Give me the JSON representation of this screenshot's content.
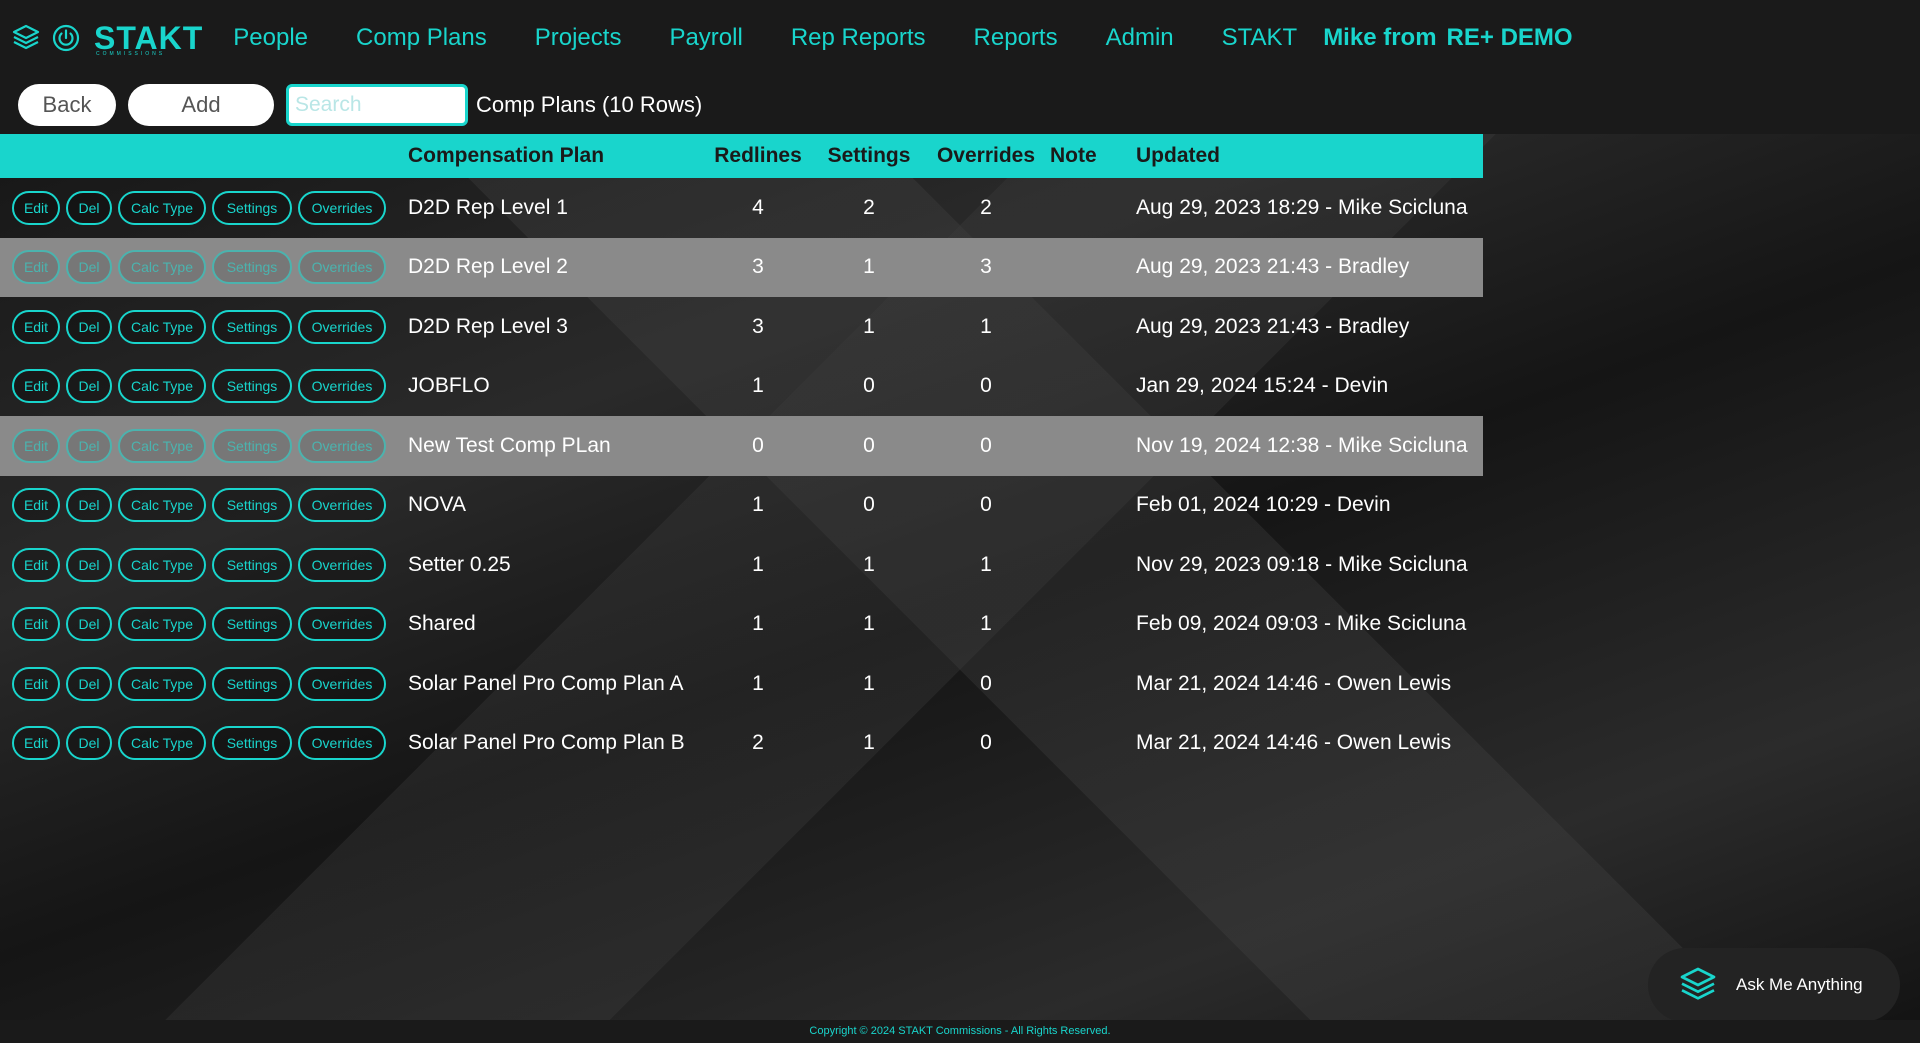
{
  "colors": {
    "accent": "#19d5cc",
    "row_highlight": "#8a8a8a"
  },
  "header": {
    "logo": "STAKT",
    "logo_sub": "COMMISSIONS",
    "nav": [
      "People",
      "Comp Plans",
      "Projects",
      "Payroll",
      "Rep Reports",
      "Reports",
      "Admin",
      "STAKT"
    ],
    "user_prefix": "Mike from",
    "user_org": "RE+ DEMO"
  },
  "toolbar": {
    "back_label": "Back",
    "add_label": "Add",
    "search_placeholder": "Search",
    "caption": "Comp Plans  (10 Rows)"
  },
  "table": {
    "columns": {
      "plan": "Compensation Plan",
      "redlines": "Redlines",
      "settings": "Settings",
      "overrides": "Overrides",
      "note": "Note",
      "updated": "Updated"
    },
    "actions": {
      "edit": "Edit",
      "del": "Del",
      "calc": "Calc Type",
      "settings": "Settings",
      "overrides": "Overrides"
    },
    "rows": [
      {
        "plan": "D2D Rep Level 1",
        "redlines": "4",
        "settings": "2",
        "overrides": "2",
        "note": "",
        "updated": "Aug 29, 2023 18:29 - Mike Scicluna",
        "highlight": false
      },
      {
        "plan": "D2D Rep Level 2",
        "redlines": "3",
        "settings": "1",
        "overrides": "3",
        "note": "",
        "updated": "Aug 29, 2023 21:43 - Bradley",
        "highlight": true
      },
      {
        "plan": "D2D Rep Level 3",
        "redlines": "3",
        "settings": "1",
        "overrides": "1",
        "note": "",
        "updated": "Aug 29, 2023 21:43 - Bradley",
        "highlight": false
      },
      {
        "plan": "JOBFLO",
        "redlines": "1",
        "settings": "0",
        "overrides": "0",
        "note": "",
        "updated": "Jan 29, 2024 15:24 - Devin",
        "highlight": false
      },
      {
        "plan": "New Test Comp PLan",
        "redlines": "0",
        "settings": "0",
        "overrides": "0",
        "note": "",
        "updated": "Nov 19, 2024 12:38 - Mike Scicluna",
        "highlight": true
      },
      {
        "plan": "NOVA",
        "redlines": "1",
        "settings": "0",
        "overrides": "0",
        "note": "",
        "updated": "Feb 01, 2024 10:29 - Devin",
        "highlight": false
      },
      {
        "plan": "Setter 0.25",
        "redlines": "1",
        "settings": "1",
        "overrides": "1",
        "note": "",
        "updated": "Nov 29, 2023 09:18 - Mike Scicluna",
        "highlight": false
      },
      {
        "plan": "Shared",
        "redlines": "1",
        "settings": "1",
        "overrides": "1",
        "note": "",
        "updated": "Feb 09, 2024 09:03 - Mike Scicluna",
        "highlight": false
      },
      {
        "plan": "Solar Panel Pro Comp Plan A",
        "redlines": "1",
        "settings": "1",
        "overrides": "0",
        "note": "",
        "updated": "Mar 21, 2024 14:46 - Owen Lewis",
        "highlight": false
      },
      {
        "plan": "Solar Panel Pro Comp Plan B",
        "redlines": "2",
        "settings": "1",
        "overrides": "0",
        "note": "",
        "updated": "Mar 21, 2024 14:46 - Owen Lewis",
        "highlight": false
      }
    ]
  },
  "assistant": {
    "label": "Ask Me Anything",
    "icon": "stack-layers-icon"
  },
  "footer": {
    "copyright": "Copyright © 2024 STAKT Commissions - All Rights Reserved."
  }
}
